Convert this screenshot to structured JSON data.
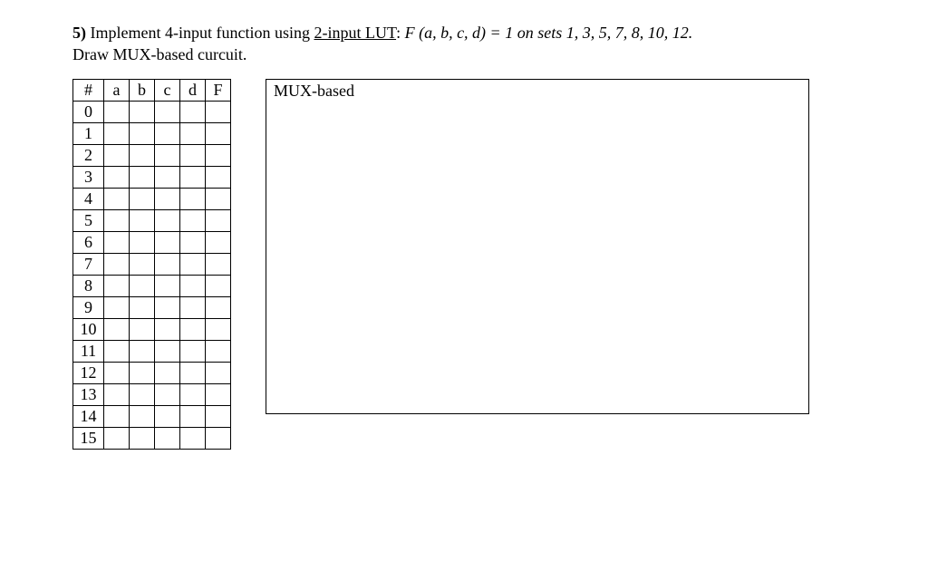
{
  "question": {
    "number": "5)",
    "text_before_ul": "Implement 4-input function using ",
    "underlined": "2-input LUT",
    "text_after_ul": ": ",
    "fn_expr": "F (a, b, c, d) = 1 on sets 1, 3, 5, 7, 8, 10, 12.",
    "line2": "Draw MUX-based curcuit."
  },
  "table": {
    "headers": [
      "#",
      "a",
      "b",
      "c",
      "d",
      "F"
    ],
    "rows": [
      "0",
      "1",
      "2",
      "3",
      "4",
      "5",
      "6",
      "7",
      "8",
      "9",
      "10",
      "11",
      "12",
      "13",
      "14",
      "15"
    ]
  },
  "mux_label": "MUX-based"
}
